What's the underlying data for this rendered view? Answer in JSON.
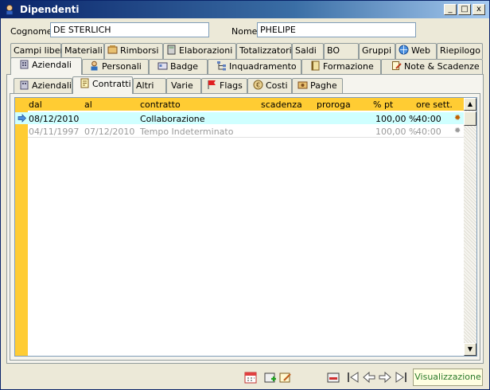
{
  "window": {
    "title": "Dipendenti"
  },
  "controls": {
    "minimize": "_",
    "maximize": "□",
    "close": "x"
  },
  "fields": {
    "cognome_label": "Cognome",
    "cognome_value": "DE STERLICH",
    "nome_label": "Nome",
    "nome_value": "PHELIPE"
  },
  "tabs_row1": [
    "Campi liberi",
    "Materiali",
    "Rimborsi",
    "Elaborazioni",
    "Totalizzatori",
    "Saldi",
    "BO",
    "Gruppi",
    "Web",
    "Riepilogo"
  ],
  "tabs_row2": [
    "Aziendali",
    "Personali",
    "Badge",
    "Inquadramento",
    "Formazione",
    "Note & Scadenze"
  ],
  "subtabs": [
    "Aziendali",
    "Contratti",
    "Altri",
    "Varie",
    "Flags",
    "Costi",
    "Paghe"
  ],
  "grid": {
    "columns": [
      "dal",
      "al",
      "contratto",
      "scadenza",
      "proroga",
      "% pt",
      "ore sett."
    ],
    "rows": [
      {
        "dal": "08/12/2010",
        "al": "",
        "contratto": "Collaborazione",
        "scadenza": "",
        "proroga": "",
        "pt": "100,00 %",
        "ore": "40:00"
      },
      {
        "dal": "04/11/1997",
        "al": "07/12/2010",
        "contratto": "Tempo Indeterminato",
        "scadenza": "",
        "proroga": "",
        "pt": "100,00 %",
        "ore": "40:00"
      }
    ]
  },
  "status": "Visualizzazione",
  "colors": {
    "header": "#ffcc33",
    "selected_row": "#cfffff",
    "title_start": "#0a246a",
    "status_text": "#2a7a2a"
  }
}
